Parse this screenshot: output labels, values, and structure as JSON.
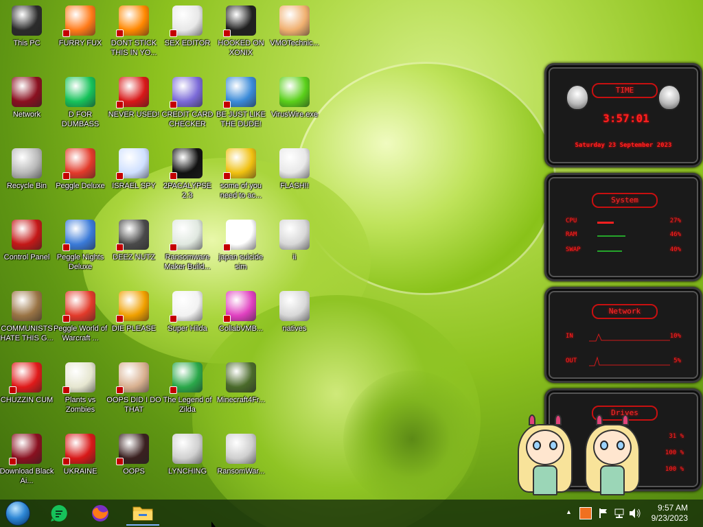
{
  "desktop": {
    "icons": [
      {
        "label": "This PC",
        "col": 0,
        "row": 0,
        "icon": "computer-icon",
        "color": "#2b2b2b",
        "shortcut": false
      },
      {
        "label": "Network",
        "col": 0,
        "row": 1,
        "icon": "network-icon",
        "color": "#8a1020",
        "shortcut": false
      },
      {
        "label": "Recycle Bin",
        "col": 0,
        "row": 2,
        "icon": "recycle-bin-icon",
        "color": "#b9b9b9",
        "shortcut": false
      },
      {
        "label": "Control Panel",
        "col": 0,
        "row": 3,
        "icon": "control-panel-icon",
        "color": "#c41818",
        "shortcut": false
      },
      {
        "label": "COMMUNISTS HATE THIS G...",
        "col": 0,
        "row": 4,
        "icon": "money-bag-icon",
        "color": "#9a7445",
        "shortcut": false
      },
      {
        "label": "CHUZZIN CUM",
        "col": 0,
        "row": 5,
        "icon": "chuzzle-icon",
        "color": "#e01a1a",
        "shortcut": true
      },
      {
        "label": "Download Black Ai...",
        "col": 0,
        "row": 6,
        "icon": "alien-app-icon",
        "color": "#8a1020",
        "shortcut": true
      },
      {
        "label": "FURRY FUX",
        "col": 1,
        "row": 0,
        "icon": "firefox-icon",
        "color": "#ff7a18",
        "shortcut": true
      },
      {
        "label": "D FOR DUMBASS",
        "col": 1,
        "row": 1,
        "icon": "chat-app-icon",
        "color": "#16c25a",
        "shortcut": false
      },
      {
        "label": "Peggle Deluxe",
        "col": 1,
        "row": 2,
        "icon": "peggle-icon",
        "color": "#e23a2a",
        "shortcut": true
      },
      {
        "label": "Peggle Nights Deluxe",
        "col": 1,
        "row": 3,
        "icon": "peggle-nights-icon",
        "color": "#3a7ad8",
        "shortcut": true
      },
      {
        "label": "Peggle World of Warcraft ...",
        "col": 1,
        "row": 4,
        "icon": "peggle-wow-icon",
        "color": "#e23a2a",
        "shortcut": true
      },
      {
        "label": "Plants vs Zombies",
        "col": 1,
        "row": 5,
        "icon": "flower-icon",
        "color": "#e6e6d0",
        "shortcut": true
      },
      {
        "label": "UKRAINE",
        "col": 1,
        "row": 6,
        "icon": "radiation-icon",
        "color": "#d81818",
        "shortcut": true
      },
      {
        "label": "DONT STICK THIS IN YO...",
        "col": 2,
        "row": 0,
        "icon": "vlc-cone-icon",
        "color": "#ff8800",
        "shortcut": true
      },
      {
        "label": "NEVER USED!",
        "col": 2,
        "row": 1,
        "icon": "devcpp-icon",
        "color": "#d81818",
        "shortcut": true
      },
      {
        "label": "ISRAEL SPY",
        "col": 2,
        "row": 2,
        "icon": "network-spy-icon",
        "color": "#cfe0ff",
        "shortcut": true
      },
      {
        "label": "DEEZ NUTZ",
        "col": 2,
        "row": 3,
        "icon": "stacked-windows-icon",
        "color": "#4a4a4a",
        "shortcut": true
      },
      {
        "label": "DIE PLEASE",
        "col": 2,
        "row": 4,
        "icon": "de-logo-icon",
        "color": "#f0a000",
        "shortcut": true
      },
      {
        "label": "OOPS DID I DO THAT",
        "col": 2,
        "row": 5,
        "icon": "portrait-icon",
        "color": "#d8b090",
        "shortcut": true
      },
      {
        "label": "OOPS",
        "col": 2,
        "row": 6,
        "icon": "dark-box-icon",
        "color": "#3a2020",
        "shortcut": true
      },
      {
        "label": "SEX EDITOR",
        "col": 3,
        "row": 0,
        "icon": "hxd-editor-icon",
        "color": "#e8e8e8",
        "shortcut": true
      },
      {
        "label": "CREDIT CARD CHECKER",
        "col": 3,
        "row": 1,
        "icon": "credit-card-icon",
        "color": "#7b6ad8",
        "shortcut": true
      },
      {
        "label": "2PACALYPSE 2.3",
        "col": 3,
        "row": 2,
        "icon": "terminal-icon",
        "color": "#111111",
        "shortcut": true
      },
      {
        "label": "Ransomware Maker Build...",
        "col": 3,
        "row": 3,
        "icon": "window-app-icon",
        "color": "#e0e8e0",
        "shortcut": true
      },
      {
        "label": "Super Hilda",
        "col": 3,
        "row": 4,
        "icon": "pixel-dog-icon",
        "color": "#f2f2f2",
        "shortcut": true
      },
      {
        "label": "The Legend of Zilda",
        "col": 3,
        "row": 5,
        "icon": "pixel-hero-icon",
        "color": "#2aa84a",
        "shortcut": true
      },
      {
        "label": "LYNCHING",
        "col": 3,
        "row": 6,
        "icon": "noose-icon",
        "color": "#d0d0d0",
        "shortcut": false
      },
      {
        "label": "HOOKED ON XONIX",
        "col": 4,
        "row": 0,
        "icon": "xonix-icon",
        "color": "#202020",
        "shortcut": true
      },
      {
        "label": "BE JUST LIKE THE DUDE!",
        "col": 4,
        "row": 1,
        "icon": "santa-dude-icon",
        "color": "#3a8ad8",
        "shortcut": true
      },
      {
        "label": "some of you need to ac...",
        "col": 4,
        "row": 2,
        "icon": "cartoon-dog-icon",
        "color": "#f0c010",
        "shortcut": true
      },
      {
        "label": "japan suicide sim",
        "col": 4,
        "row": 3,
        "icon": "white-doc-icon",
        "color": "#ffffff",
        "shortcut": true
      },
      {
        "label": "CollabVMB...",
        "col": 4,
        "row": 4,
        "icon": "monitor-icon",
        "color": "#e040c0",
        "shortcut": true
      },
      {
        "label": "Minecraft4Fr...",
        "col": 4,
        "row": 5,
        "icon": "grass-block-icon",
        "color": "#4a6a2a",
        "shortcut": false
      },
      {
        "label": "RansomWar...",
        "col": 4,
        "row": 6,
        "icon": "skull-icon",
        "color": "#cfcfcf",
        "shortcut": false
      },
      {
        "label": "VMOTechnic...",
        "col": 5,
        "row": 0,
        "icon": "doctor-icon",
        "color": "#f0b070",
        "shortcut": false
      },
      {
        "label": "VirusWire.exe",
        "col": 5,
        "row": 1,
        "icon": "lime-icon",
        "color": "#5ad01a",
        "shortcut": false
      },
      {
        "label": "FLASH!!",
        "col": 5,
        "row": 2,
        "icon": "flash-file-icon",
        "color": "#e8e8e8",
        "shortcut": false
      },
      {
        "label": "ii",
        "col": 5,
        "row": 3,
        "icon": "file-icon",
        "color": "#d8d8d8",
        "shortcut": false
      },
      {
        "label": "natives",
        "col": 5,
        "row": 4,
        "icon": "file-icon",
        "color": "#d8d8d8",
        "shortcut": false
      }
    ]
  },
  "widget": {
    "time": {
      "header": "TIME",
      "clock": "3:57:01",
      "date": "Saturday 23 September 2023"
    },
    "system": {
      "header": "System",
      "rows": [
        {
          "key": "CPU",
          "value": "27%",
          "level": 0.27
        },
        {
          "key": "RAM",
          "value": "46%",
          "level": 0.46
        },
        {
          "key": "SWAP",
          "value": "40%",
          "level": 0.4
        }
      ]
    },
    "network": {
      "header": "Network",
      "rows": [
        {
          "key": "IN",
          "value": "10%"
        },
        {
          "key": "OUT",
          "value": "5%"
        }
      ]
    },
    "drives": {
      "header": "Drives",
      "values": [
        "31 %",
        "100 %",
        "100 %"
      ]
    }
  },
  "taskbar": {
    "pinned": [
      {
        "name": "start-button",
        "icon": "start-orb-icon"
      },
      {
        "name": "taskbar-chat-app",
        "icon": "chat-app-icon"
      },
      {
        "name": "taskbar-firefox",
        "icon": "firefox-icon"
      },
      {
        "name": "taskbar-file-explorer",
        "icon": "folder-icon"
      }
    ],
    "tray": {
      "chevron": "▲",
      "time": "9:57 AM",
      "date": "9/23/2023"
    }
  },
  "colors": {
    "widget_red": "#ff2020",
    "taskbar_bg": "#142c0a",
    "shortcut_badge": "#c40000"
  }
}
